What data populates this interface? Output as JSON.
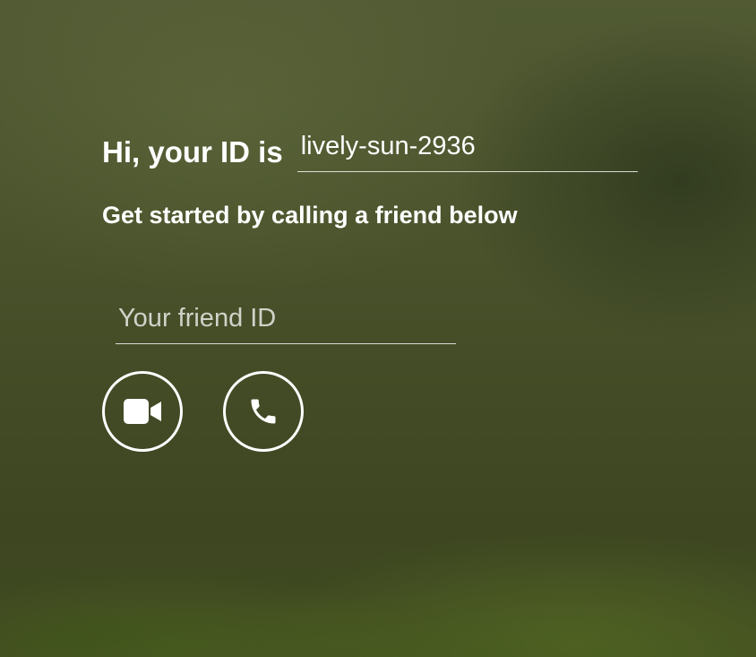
{
  "greeting": {
    "label": "Hi, your ID is",
    "id_value": "lively-sun-2936"
  },
  "subtitle": "Get started by calling a friend below",
  "friend_input": {
    "value": "",
    "placeholder": "Your friend ID"
  },
  "actions": {
    "video_call_icon": "video-camera-icon",
    "audio_call_icon": "phone-icon"
  },
  "colors": {
    "text": "#ffffff",
    "background": "#4a532c"
  }
}
